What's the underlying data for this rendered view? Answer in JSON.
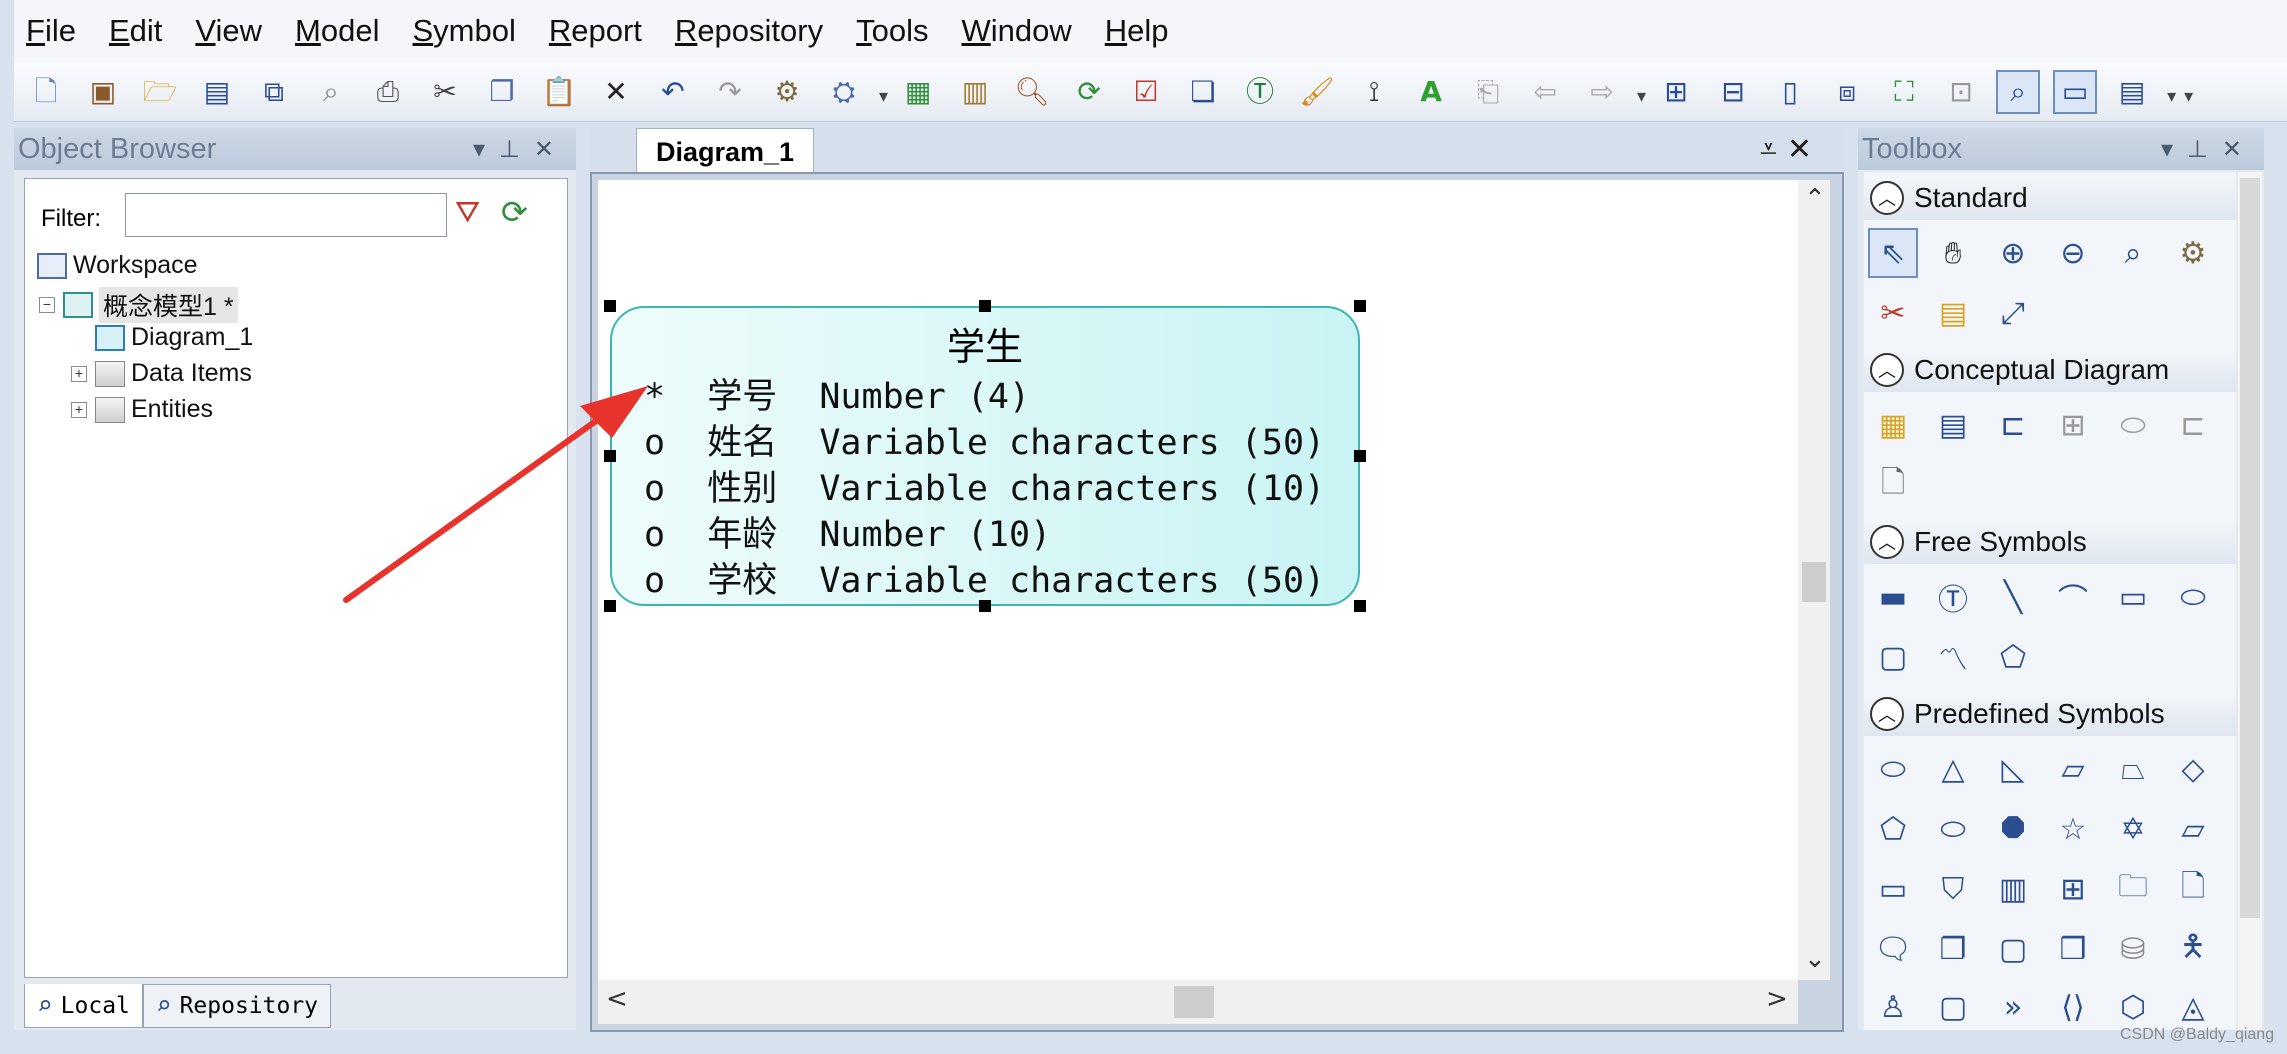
{
  "menubar": {
    "items": [
      {
        "mnemonic": "F",
        "rest": "ile"
      },
      {
        "mnemonic": "E",
        "rest": "dit"
      },
      {
        "mnemonic": "V",
        "rest": "iew"
      },
      {
        "mnemonic": "M",
        "rest": "odel"
      },
      {
        "mnemonic": "S",
        "rest": "ymbol"
      },
      {
        "mnemonic": "R",
        "rest": "eport"
      },
      {
        "mnemonic": "R",
        "rest": "epository"
      },
      {
        "mnemonic": "T",
        "rest": "ools"
      },
      {
        "mnemonic": "W",
        "rest": "indow"
      },
      {
        "mnemonic": "H",
        "rest": "elp"
      }
    ]
  },
  "toolbar": {
    "icons": [
      "new-icon",
      "open-model-icon",
      "open-folder-icon",
      "save-icon",
      "save-all-icon",
      "print-preview-icon",
      "print-icon",
      "cut-icon",
      "copy-icon",
      "paste-icon",
      "delete-icon",
      "undo-icon",
      "redo-icon",
      "properties-icon",
      "check-model-icon",
      "new-package-icon",
      "paste-special-icon",
      "find-icon",
      "refresh-icon",
      "validate-icon",
      "shadow-icon",
      "text-icon",
      "format-painter-icon",
      "line-style-icon",
      "font-color-icon",
      "send-back-icon",
      "align-left-icon",
      "align-right-icon",
      "diagram-1-icon",
      "diagram-2-icon",
      "diagram-3-icon",
      "diagram-4-icon",
      "diagram-5-icon",
      "diagram-6-icon",
      "view-icon",
      "window-icon",
      "table-icon"
    ]
  },
  "object_browser": {
    "title": "Object Browser",
    "filter_label": "Filter:",
    "filter_value": "",
    "tree": {
      "workspace": "Workspace",
      "model": "概念模型1 *",
      "diagram": "Diagram_1",
      "data_items": "Data Items",
      "entities": "Entities"
    },
    "tabs": {
      "local": "Local",
      "repository": "Repository"
    }
  },
  "diagram": {
    "tab_label": "Diagram_1",
    "entity": {
      "name": "学生",
      "attributes": [
        "*  学号  Number (4)",
        "o  姓名  Variable characters (50)",
        "o  性别  Variable characters (10)",
        "o  年龄  Number (10)",
        "o  学校  Variable characters (50)"
      ]
    }
  },
  "toolbox": {
    "title": "Toolbox",
    "sections": {
      "standard": "Standard",
      "conceptual": "Conceptual Diagram",
      "free": "Free Symbols",
      "predefined": "Predefined Symbols"
    }
  },
  "watermark": "CSDN @Baldy_qiang",
  "colors": {
    "entity_border": "#3cb6b2",
    "entity_fill": "#c9f3f3",
    "arrow": "#e8322c"
  }
}
